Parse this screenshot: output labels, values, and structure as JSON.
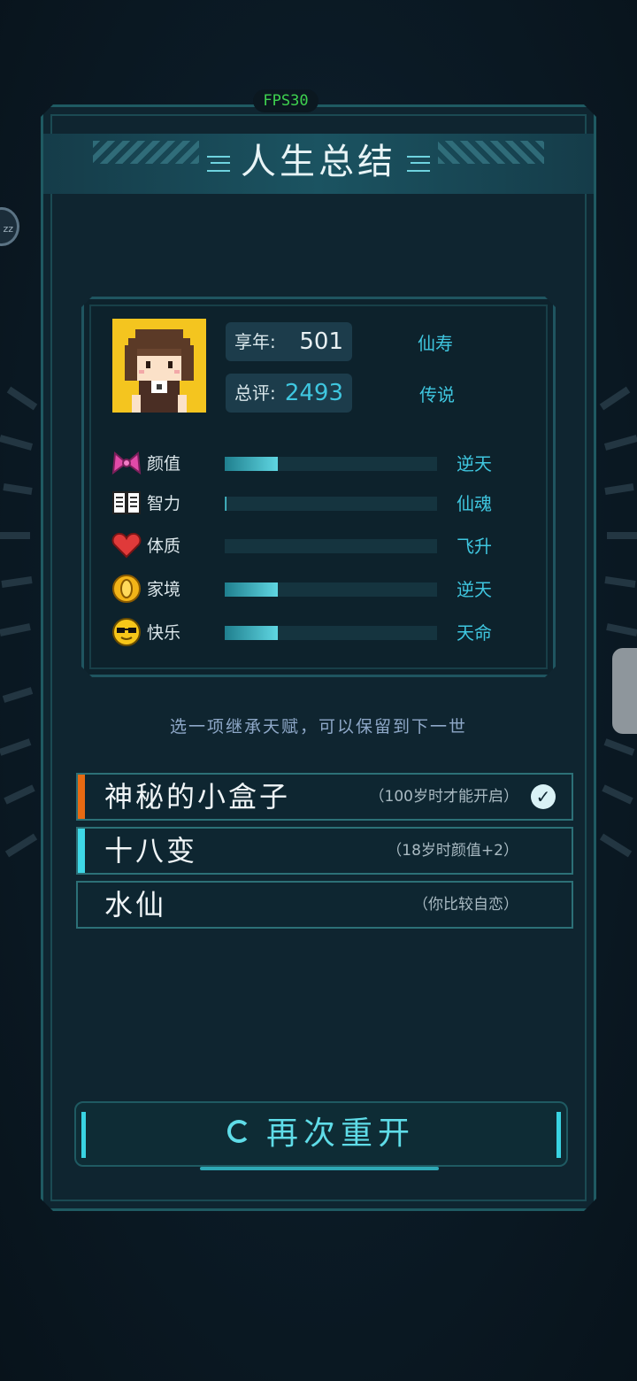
{
  "hud": {
    "fps_label": "FPS30",
    "side_bubble": "zz"
  },
  "header": {
    "title": "人生总结"
  },
  "summary": {
    "age_label": "享年:",
    "age_value": "501",
    "age_rank": "仙寿",
    "score_label": "总评:",
    "score_value": "2493",
    "score_rank": "传说"
  },
  "attributes": [
    {
      "icon": "bow-icon",
      "name": "颜值",
      "grade": "逆天",
      "fill": 0.25,
      "color": "#e14aa8"
    },
    {
      "icon": "book-icon",
      "name": "智力",
      "grade": "仙魂",
      "fill": 0.01,
      "color": "#ffffff"
    },
    {
      "icon": "heart-icon",
      "name": "体质",
      "grade": "飞升",
      "fill": 0.0,
      "color": "#e03a3a"
    },
    {
      "icon": "coin-icon",
      "name": "家境",
      "grade": "逆天",
      "fill": 0.25,
      "color": "#f2b418"
    },
    {
      "icon": "sunglasses-face-icon",
      "name": "快乐",
      "grade": "天命",
      "fill": 0.25,
      "color": "#f6c619"
    }
  ],
  "hint": "选一项继承天赋，可以保留到下一世",
  "talents": [
    {
      "name": "神秘的小盒子",
      "desc": "（100岁时才能开启）",
      "accent": "#e86a12",
      "checked": true
    },
    {
      "name": "十八变",
      "desc": "（18岁时颜值+2）",
      "accent": "#3ed7e6",
      "checked": false
    },
    {
      "name": "水仙",
      "desc": "（你比较自恋）",
      "accent": "",
      "checked": false
    }
  ],
  "restart": {
    "label": "再次重开"
  },
  "colors": {
    "accent": "#3fc6df",
    "panel": "#0f2530",
    "border": "#1f5a62"
  }
}
